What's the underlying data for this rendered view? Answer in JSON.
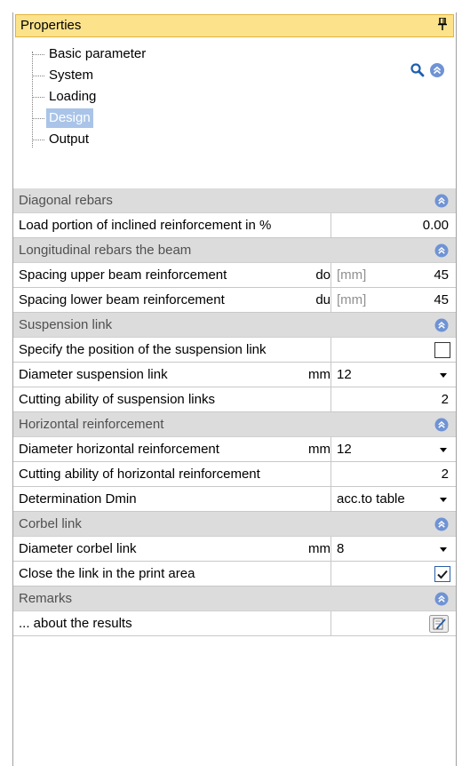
{
  "header": {
    "title": "Properties",
    "pin_glyph": "Ţ"
  },
  "tree": {
    "items": [
      {
        "label": "Basic parameter",
        "selected": false
      },
      {
        "label": "System",
        "selected": false
      },
      {
        "label": "Loading",
        "selected": false
      },
      {
        "label": "Design",
        "selected": true
      },
      {
        "label": "Output",
        "selected": false
      }
    ],
    "icons": {
      "search": "search-icon",
      "collapse": "double-chevron-up-icon"
    }
  },
  "sections": {
    "diagonal": {
      "title": "Diagonal rebars",
      "load_portion": {
        "label": "Load portion of inclined reinforcement in %",
        "value": "0.00"
      }
    },
    "longitudinal": {
      "title": "Longitudinal rebars the beam",
      "upper": {
        "label": "Spacing upper beam reinforcement",
        "symbol": "do",
        "unit": "[mm]",
        "value": "45"
      },
      "lower": {
        "label": "Spacing lower beam reinforcement",
        "symbol": "du",
        "unit": "[mm]",
        "value": "45"
      }
    },
    "suspension": {
      "title": "Suspension link",
      "specify": {
        "label": "Specify the position of the suspension link",
        "checked": false
      },
      "diameter": {
        "label": "Diameter suspension link",
        "unit": "mm",
        "value": "12"
      },
      "cutting": {
        "label": "Cutting ability of suspension links",
        "value": "2"
      }
    },
    "horizontal": {
      "title": "Horizontal reinforcement",
      "diameter": {
        "label": "Diameter horizontal reinforcement",
        "unit": "mm",
        "value": "12"
      },
      "cutting": {
        "label": "Cutting ability of horizontal reinforcement",
        "value": "2"
      },
      "dmin": {
        "label": "Determination Dmin",
        "value": "acc.to table"
      }
    },
    "corbel": {
      "title": "Corbel link",
      "diameter": {
        "label": "Diameter corbel link",
        "unit": "mm",
        "value": "8"
      },
      "close": {
        "label": "Close the link in the print area",
        "checked": true
      }
    },
    "remarks": {
      "title": "Remarks",
      "results": {
        "label": "... about the results"
      }
    }
  },
  "colors": {
    "title_bar": "#fce28a",
    "section_bg": "#dcdcdc",
    "selected_bg": "#a9c4e8",
    "expander": "#6f93d4"
  }
}
